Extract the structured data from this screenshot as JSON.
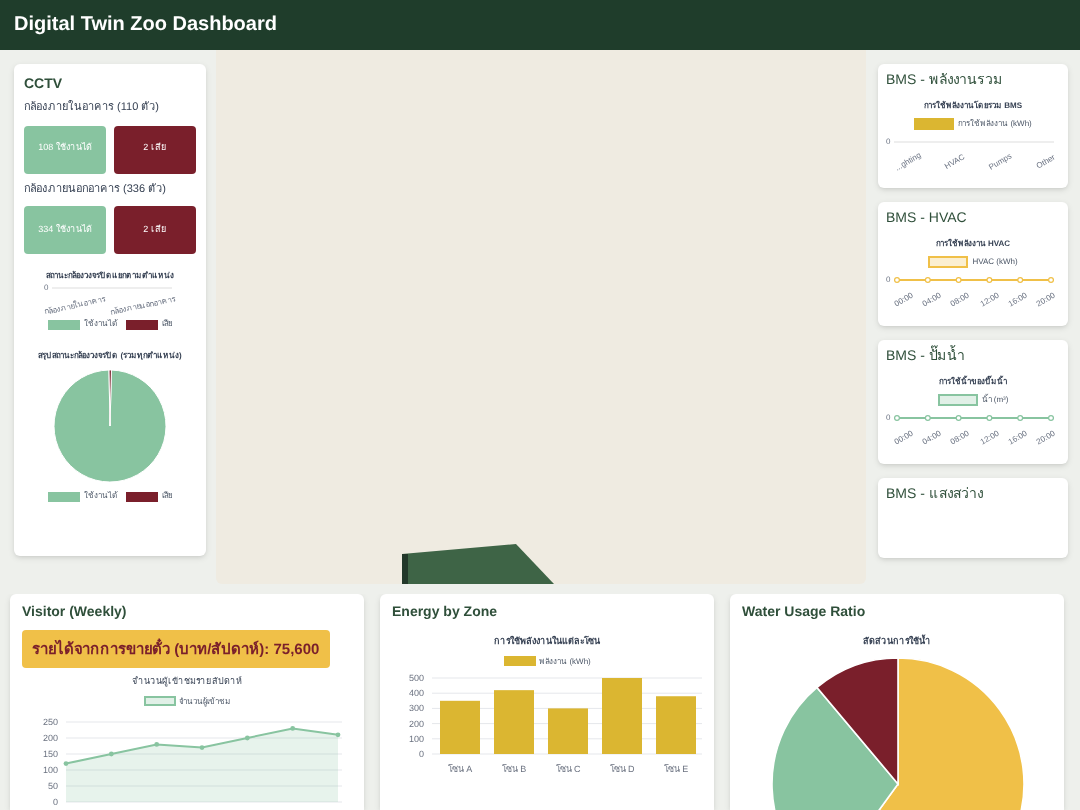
{
  "header": {
    "title": "Digital Twin Zoo Dashboard"
  },
  "cctv": {
    "title": "CCTV",
    "groups": [
      {
        "label": "กล้องภายในอาคาร (110 ตัว)",
        "working": "108 ใช้งานได้",
        "broken": "2 เสีย"
      },
      {
        "label": "กล้องภายนอกอาคาร (336 ตัว)",
        "working": "334 ใช้งานได้",
        "broken": "2 เสีย"
      }
    ],
    "location_chart": {
      "title": "สถานะกล้องวงจรปิดแยกตามตำแหน่ง",
      "ytick": "0",
      "categories": [
        "กล้องภายในอาคาร",
        "กล้องภายนอกอาคาร"
      ],
      "legend": [
        {
          "label": "ใช้งานได้",
          "color": "#88c4a0"
        },
        {
          "label": "เสีย",
          "color": "#7a1f2b"
        }
      ]
    },
    "summary_chart": {
      "title": "สรุปสถานะกล้องวงจรปิด (รวมทุกตำแหน่ง)",
      "legend": [
        {
          "label": "ใช้งานได้",
          "color": "#88c4a0"
        },
        {
          "label": "เสีย",
          "color": "#7a1f2b"
        }
      ]
    }
  },
  "bms": [
    {
      "title": "BMS - พลังงานรวม",
      "kind": "bar",
      "chart_title": "การใช้พลังงานโดยรวม BMS",
      "legend": {
        "label": "การใช้พลังงาน (kWh)",
        "color": "#dbb631"
      },
      "ytick": "0",
      "labels": [
        "...ghting",
        "HVAC",
        "Pumps",
        "Other"
      ]
    },
    {
      "title": "BMS - HVAC",
      "kind": "line",
      "chart_title": "การใช้พลังงาน HVAC",
      "legend": {
        "label": "HVAC (kWh)",
        "color": "#f0c048"
      },
      "ytick": "0",
      "labels": [
        "00:00",
        "04:00",
        "08:00",
        "12:00",
        "16:00",
        "20:00"
      ]
    },
    {
      "title": "BMS - ปั๊มน้ำ",
      "kind": "line",
      "chart_title": "การใช้น้ำของปั๊มน้ำ",
      "legend": {
        "label": "น้ำ (m³)",
        "color": "#88c4a0"
      },
      "ytick": "0",
      "labels": [
        "00:00",
        "04:00",
        "08:00",
        "12:00",
        "16:00",
        "20:00"
      ]
    },
    {
      "title": "BMS - แสงสว่าง",
      "kind": "none"
    }
  ],
  "visitor": {
    "title": "Visitor (Weekly)",
    "revenue": "รายได้จากการขายตั๋ว (บาท/สัปดาห์): 75,600",
    "chart_data": {
      "type": "area",
      "grid": true,
      "title": "จำนวนผู้เข้าชมรายสัปดาห์",
      "ylim": [
        0,
        250
      ],
      "yticks": [
        0,
        50,
        100,
        150,
        200,
        250
      ],
      "series": [
        {
          "name": "จำนวนผู้เข้าชม",
          "color": "#88c4a0",
          "values": [
            120,
            150,
            180,
            170,
            200,
            230,
            210
          ]
        }
      ]
    }
  },
  "energy": {
    "title": "Energy by Zone",
    "chart_data": {
      "type": "bar",
      "grid": true,
      "title": "การใช้พลังงานในแต่ละโซน",
      "categories": [
        "โซน A",
        "โซน B",
        "โซน C",
        "โซน D",
        "โซน E"
      ],
      "ylim": [
        0,
        500
      ],
      "yticks": [
        0,
        100,
        200,
        300,
        400,
        500
      ],
      "series": [
        {
          "name": "พลังงาน (kWh)",
          "color": "#dbb631",
          "values": [
            350,
            420,
            300,
            500,
            380
          ]
        }
      ]
    }
  },
  "water": {
    "title": "Water Usage Ratio",
    "chart_title": "สัดส่วนการใช้น้ำ"
  }
}
